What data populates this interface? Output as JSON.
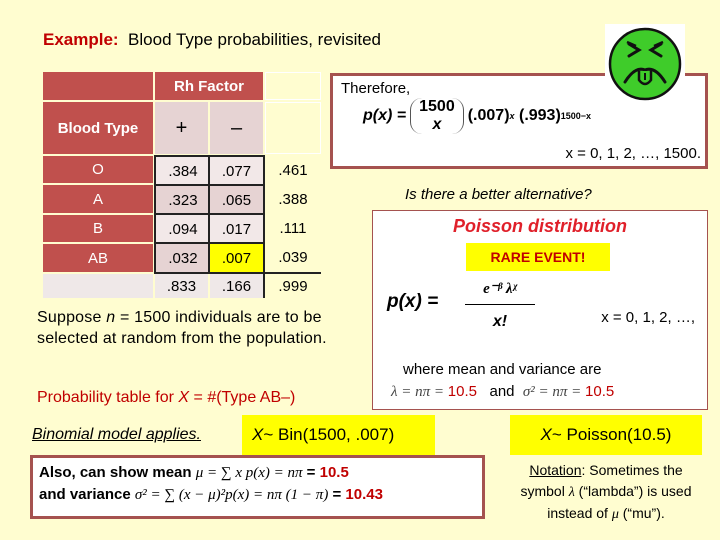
{
  "title": {
    "prefix": "Example:",
    "text": "Blood Type probabilities, revisited"
  },
  "table": {
    "rh_header": "Rh Factor",
    "row_header": "Blood Type",
    "col_plus": "+",
    "col_minus": "–",
    "rows": [
      {
        "label": "O",
        "plus": ".384",
        "minus": ".077",
        "total": ".461"
      },
      {
        "label": "A",
        "plus": ".323",
        "minus": ".065",
        "total": ".388"
      },
      {
        "label": "B",
        "plus": ".094",
        "minus": ".017",
        "total": ".111"
      },
      {
        "label": "AB",
        "plus": ".032",
        "minus": ".007",
        "total": ".039"
      }
    ],
    "totals": {
      "plus": ".833",
      "minus": ".166",
      "total": ".999"
    }
  },
  "binomial_box": {
    "therefore": "Therefore,",
    "px": "p(x) =",
    "binom_top": "1500",
    "binom_bottom": "x",
    "term1": "(.007)",
    "exp1": "x",
    "term2": "(.993)",
    "exp2": "1500−x",
    "range": "x = 0, 1, 2, …, 1500."
  },
  "face_icon": "disgusted-face",
  "question": "Is there a better alternative?",
  "poisson_box": {
    "title": "Poisson distribution",
    "badge": "RARE EVENT!",
    "px": "p(x)  =",
    "numerator": "e⁻ᵝ λᵡ",
    "denominator": "x!",
    "range": "x = 0, 1, 2, …,",
    "where": "where mean and variance are",
    "lambda_expr": "λ = nπ = ",
    "lambda_val": "10.5",
    "and": "and",
    "sigma_expr": "σ² = nπ = ",
    "sigma_val": "10.5"
  },
  "suppose_text": "Suppose n = 1500 individuals are to be selected at random from the population.",
  "suppose": {
    "a": "Suppose ",
    "n": "n",
    "b": " = 1500 individuals are to be selected at random from the population."
  },
  "prob_table_text": {
    "a": "Probability table for ",
    "x": "X",
    "b": " = #(Type AB–)"
  },
  "binomial_applies": "Binomial model applies",
  "binomial_dist": {
    "x": "X",
    "text": " ~ Bin(1500, .007)"
  },
  "poisson_dist": {
    "x": "X",
    "text": " ~ Poisson(10.5)"
  },
  "also_box": {
    "line1_a": "Also, can show mean ",
    "line1_m": "μ = ∑ x p(x)  =  nπ",
    "line1_eq": "  =  ",
    "line1_val": "10.5",
    "line2_a": "and variance  ",
    "line2_m": "σ² = ∑ (x − μ)²p(x)  =  nπ (1 − π)",
    "line2_eq": " =  ",
    "line2_val": "10.43"
  },
  "notation": {
    "label": "Notation",
    "text1": ": Sometimes the symbol ",
    "lambda": "λ",
    "text2": " (“lambda”) is used instead of ",
    "mu": "μ",
    "text3": " (“mu”)."
  }
}
